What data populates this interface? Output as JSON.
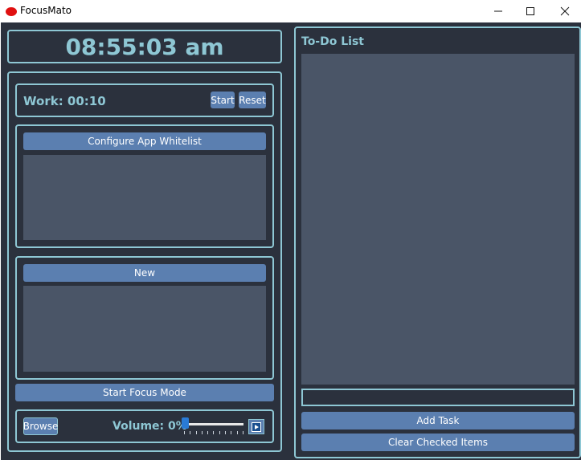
{
  "window": {
    "title": "FocusMato"
  },
  "clock": {
    "time": "08:55:03 am"
  },
  "timer": {
    "label": "Work: 00:10",
    "start_label": "Start",
    "reset_label": "Reset"
  },
  "whitelist": {
    "button_label": "Configure App Whitelist"
  },
  "new_panel": {
    "button_label": "New"
  },
  "focus": {
    "button_label": "Start Focus Mode"
  },
  "music": {
    "browse_label": "Browse",
    "volume_label": "Volume: 0%",
    "volume_level": 0
  },
  "todo": {
    "title": "To-Do List",
    "input_value": "",
    "add_label": "Add Task",
    "clear_label": "Clear Checked Items"
  },
  "colors": {
    "accent": "#8ec7d4",
    "button": "#5b7fb0",
    "background": "#2b313d",
    "pane": "#4a5567"
  },
  "icons": {
    "app": "tomato-icon",
    "minimize": "minimize-icon",
    "maximize": "maximize-icon",
    "close": "close-icon",
    "play": "play-icon"
  }
}
